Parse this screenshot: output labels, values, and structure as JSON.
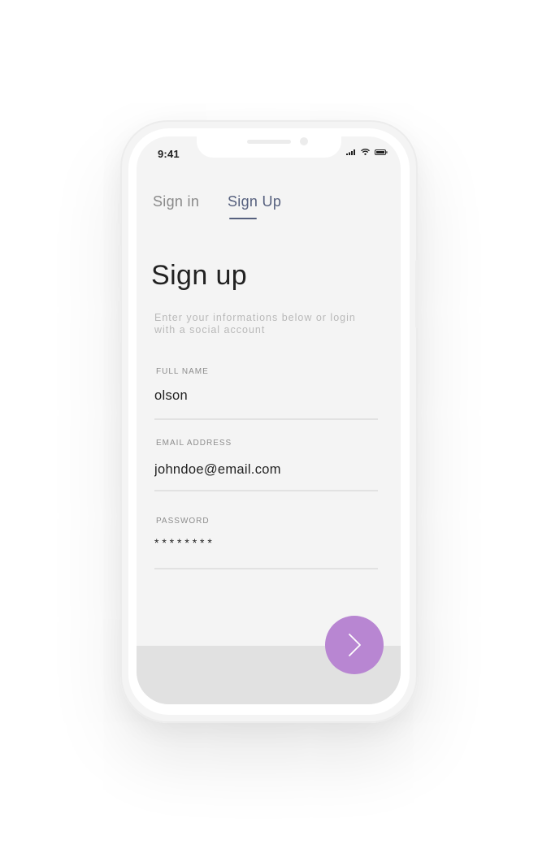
{
  "status_bar": {
    "time": "9:41"
  },
  "tabs": {
    "sign_in": "Sign in",
    "sign_up": "Sign Up"
  },
  "main": {
    "title": "Sign up",
    "subtitle": "Enter your informations below or login with a social account"
  },
  "form": {
    "full_name": {
      "label": "FULL NAME",
      "value": "olson"
    },
    "email": {
      "label": "EMAIL ADDRESS",
      "value": "johndoe@email.com"
    },
    "password": {
      "label": "PASSWORD",
      "value": "* * * * * * * *"
    }
  },
  "submit_button": {
    "icon": "chevron-right-icon"
  },
  "colors": {
    "accent": "#b886d2",
    "active_tab": "#56607e",
    "screen_background": "#f4f4f4",
    "bottom_band": "#e1e1e1"
  }
}
